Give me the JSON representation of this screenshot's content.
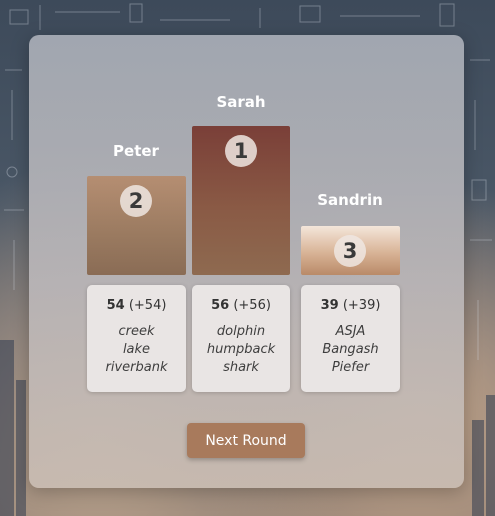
{
  "podium": [
    {
      "place": "1",
      "name": "Sarah",
      "score": "56",
      "delta": "(+56)",
      "words": [
        "dolphin",
        "humpback",
        "shark"
      ]
    },
    {
      "place": "2",
      "name": "Peter",
      "score": "54",
      "delta": "(+54)",
      "words": [
        "creek",
        "lake",
        "riverbank"
      ]
    },
    {
      "place": "3",
      "name": "Sandrin",
      "score": "39",
      "delta": "(+39)",
      "words": [
        "ASJA",
        "Bangash",
        "Piefer"
      ]
    }
  ],
  "actions": {
    "next_round_label": "Next Round"
  },
  "colors": {
    "button": "#a87a5c",
    "first_bar": "#7a3f38",
    "second_bar": "#b58e72",
    "third_bar": "#d8b396"
  }
}
